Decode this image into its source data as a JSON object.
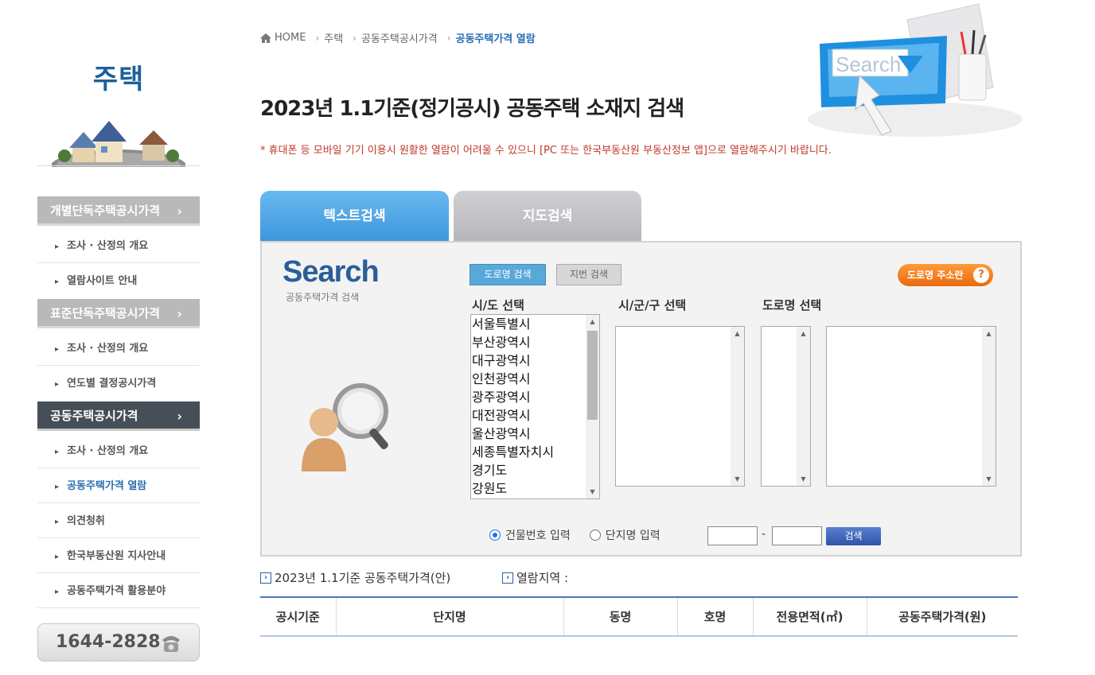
{
  "sidebar": {
    "title": "주택",
    "menu": [
      {
        "label": "개별단독주택공시가격",
        "type": "head"
      },
      {
        "label": "조사 · 산정의 개요",
        "type": "sub"
      },
      {
        "label": "열람사이트 안내",
        "type": "sub"
      },
      {
        "label": "표준단독주택공시가격",
        "type": "head"
      },
      {
        "label": "조사 · 산정의 개요",
        "type": "sub"
      },
      {
        "label": "연도별 결정공시가격",
        "type": "sub"
      },
      {
        "label": "공동주택공시가격",
        "type": "head-active"
      },
      {
        "label": "조사 · 산정의 개요",
        "type": "sub"
      },
      {
        "label": "공동주택가격 열람",
        "type": "sub-current"
      },
      {
        "label": "의견청취",
        "type": "sub"
      },
      {
        "label": "한국부동산원 지사안내",
        "type": "sub"
      },
      {
        "label": "공동주택가격 활용분야",
        "type": "sub"
      }
    ],
    "phone": "1644-2828"
  },
  "breadcrumb": [
    "HOME",
    "주택",
    "공동주택공시가격",
    "공동주택가격 열람"
  ],
  "page_title": "2023년 1.1기준(정기공시) 공동주택 소재지 검색",
  "notice": "* 휴대폰 등 모바일 기기 이용시 원활한 열람이 어려울 수 있으니 [PC 또는 한국부동산원 부동산정보 앱]으로 열람해주시기 바랍니다.",
  "header_illust_text": "Search",
  "tabs": {
    "text_search": "텍스트검색",
    "map_search": "지도검색"
  },
  "panel": {
    "logo": "Search",
    "logo_sub": "공동주택가격 검색",
    "btn_road": "도로명 검색",
    "btn_lot": "지번 검색",
    "btn_addr": "도로명 주소란",
    "btn_addr_q": "?",
    "label_sido": "시/도 선택",
    "label_sigungu": "시/군/구 선택",
    "label_road": "도로명 선택",
    "sido_options": [
      "서울특별시",
      "부산광역시",
      "대구광역시",
      "인천광역시",
      "광주광역시",
      "대전광역시",
      "울산광역시",
      "세종특별자치시",
      "경기도",
      "강원도"
    ],
    "radio_building": "건물번호 입력",
    "radio_complex": "단지명 입력",
    "dash": "-",
    "btn_search": "검색"
  },
  "info": {
    "price_label": "2023년 1.1기준 공동주택가격(안)",
    "region_label": "열람지역 :"
  },
  "table_headers": [
    "공시기준",
    "단지명",
    "동명",
    "호명",
    "전용면적(㎡)",
    "공동주택가격(원)"
  ],
  "colors": {
    "accent_blue": "#3c96dc",
    "title_blue": "#1e5f9a",
    "notice_red": "#c0392b",
    "orange": "#e96a0c"
  }
}
